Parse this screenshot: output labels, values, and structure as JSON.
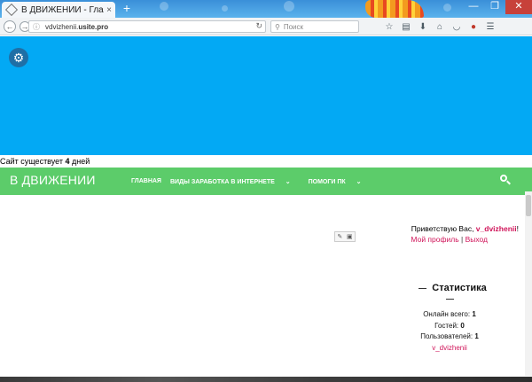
{
  "browser": {
    "tab_title": "В ДВИЖЕНИИ - Главная ...",
    "tab_close": "×",
    "new_tab": "+",
    "url_host": "vdvizhenii.",
    "url_rest": "usite.pro",
    "search_placeholder": "Поиск",
    "window_minimize": "—",
    "window_restore": "❐",
    "window_close": "✕"
  },
  "site": {
    "exists_prefix": "Сайт существует ",
    "exists_days": "4",
    "exists_suffix": " дней",
    "brand": "В ДВИЖЕНИИ",
    "menu": [
      "ГЛАВНАЯ",
      "ВИДЫ ЗАРАБОТКА В ИНТЕРНЕТЕ",
      "ПОМОГИ ПК"
    ],
    "greeting_prefix": "Приветствую Вас, ",
    "username": "v_dvizhenii",
    "greeting_suffix": "!",
    "profile_link": "Мой профиль",
    "links_sep": " | ",
    "logout_link": "Выход",
    "stats_title": "Статистика",
    "stats": {
      "online_label": "Онлайн всего: ",
      "online_value": "1",
      "guests_label": "Гостей: ",
      "guests_value": "0",
      "users_label": "Пользователей: ",
      "users_value": "1",
      "user_link": "v_dvizhenii"
    }
  },
  "colors": {
    "hero": "#03a9f4",
    "green_bar": "#5ccc6a",
    "accent_link": "#d0155a"
  },
  "icons": [
    "settings-gear-icon",
    "search-icon",
    "back-icon",
    "forward-icon",
    "reload-icon",
    "edit-icon"
  ]
}
